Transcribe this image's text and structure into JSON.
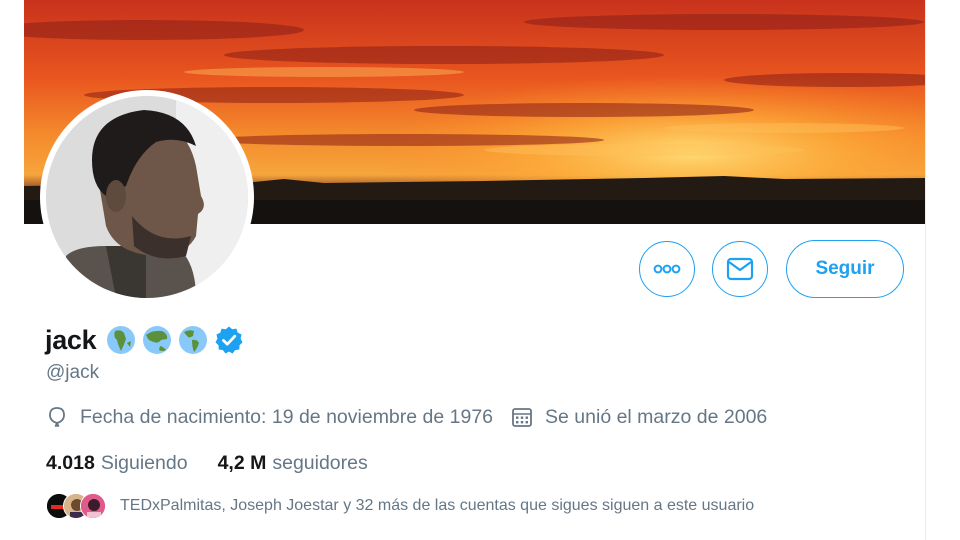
{
  "profile": {
    "display_name": "jack",
    "handle": "@jack",
    "verified": true,
    "name_emojis": [
      "globe-africa-icon",
      "globe-asia-icon",
      "globe-americas-icon"
    ]
  },
  "actions": {
    "more_icon": "more-icon",
    "message_icon": "envelope-icon",
    "follow_label": "Seguir"
  },
  "meta": {
    "birthday": "Fecha de nacimiento: 19 de noviembre de 1976",
    "joined": "Se unió el marzo de 2006"
  },
  "stats": {
    "following_count": "4.018",
    "following_label": "Siguiendo",
    "followers_count": "4,2 M",
    "followers_label": "seguidores"
  },
  "followed_by": {
    "text": "TEDxPalmitas, Joseph Joestar y 32 más de las cuentas que sigues siguen a este usuario"
  },
  "colors": {
    "accent": "#1da1f2",
    "secondary_text": "#657786",
    "primary_text": "#14171a"
  }
}
